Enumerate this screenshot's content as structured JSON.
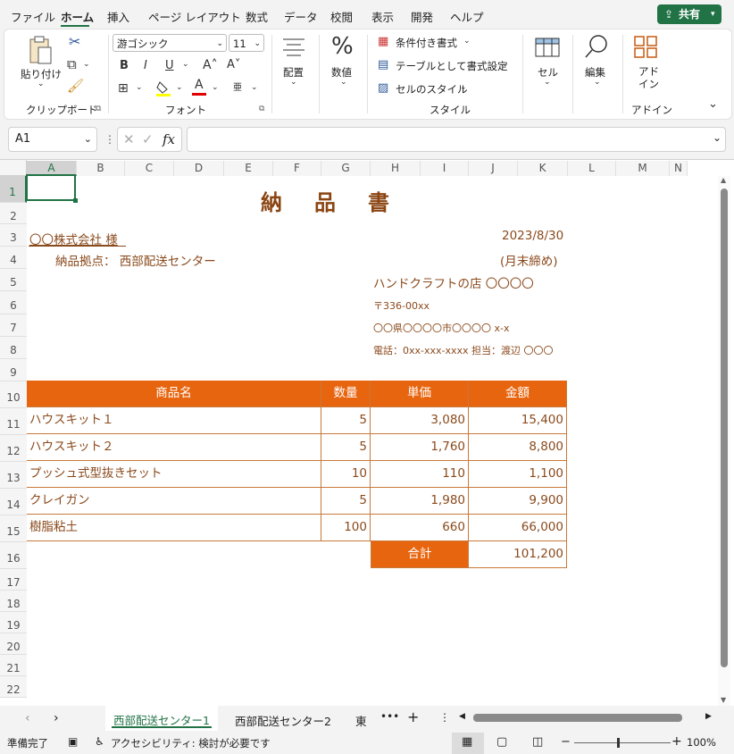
{
  "menu": {
    "items": [
      "ファイル",
      "ホーム",
      "挿入",
      "ページ レイアウト",
      "数式",
      "データ",
      "校閲",
      "表示",
      "開発",
      "ヘルプ"
    ],
    "share_label": "共有"
  },
  "ribbon": {
    "clipboard": {
      "paste": "貼り付け",
      "group": "クリップボード"
    },
    "font": {
      "name": "游ゴシック",
      "size": "11",
      "group": "フォント"
    },
    "alignment": {
      "label": "配置"
    },
    "number": {
      "label": "数値"
    },
    "styles": {
      "conditional": "条件付き書式",
      "table": "テーブルとして書式設定",
      "cell_styles": "セルのスタイル",
      "group": "スタイル"
    },
    "cells": {
      "label": "セル"
    },
    "editing": {
      "label": "編集"
    },
    "addins": {
      "label": "アド\nイン",
      "group": "アドイン"
    }
  },
  "formula_bar": {
    "name_box": "A1",
    "fx": "fx",
    "content": ""
  },
  "columns": [
    "A",
    "B",
    "C",
    "D",
    "E",
    "F",
    "G",
    "H",
    "I",
    "J",
    "K",
    "L",
    "M",
    "N"
  ],
  "rows": [
    "1",
    "2",
    "3",
    "4",
    "5",
    "6",
    "7",
    "8",
    "9",
    "10",
    "11",
    "12",
    "13",
    "14",
    "15",
    "16",
    "17",
    "18",
    "19",
    "20",
    "21",
    "22"
  ],
  "sheet": {
    "title": "納　品　書",
    "customer": "〇〇株式会社 様",
    "delivery_point": "納品拠点： 西部配送センター",
    "date": "2023/8/30",
    "closing": "(月末締め)",
    "shop": "ハンドクラフトの店 〇〇〇〇",
    "postal": "〒336-00xx",
    "address": "〇〇県〇〇〇〇市〇〇〇〇 x-x",
    "phone": "電話：0xx-xxx-xxxx 担当：渡辺 〇〇〇",
    "table": {
      "headers": [
        "商品名",
        "数量",
        "単価",
        "金額"
      ],
      "rows": [
        [
          "ハウスキット１",
          "5",
          "3,080",
          "15,400"
        ],
        [
          "ハウスキット２",
          "5",
          "1,760",
          "8,800"
        ],
        [
          "プッシュ式型抜きセット",
          "10",
          "110",
          "1,100"
        ],
        [
          "クレイガン",
          "5",
          "1,980",
          "9,900"
        ],
        [
          "樹脂粘土",
          "100",
          "660",
          "66,000"
        ]
      ],
      "total_label": "合計",
      "total_value": "101,200"
    }
  },
  "tabs": {
    "items": [
      "西部配送センター1",
      "西部配送センター2",
      "東"
    ],
    "active": 0
  },
  "status": {
    "ready": "準備完了",
    "accessibility": "アクセシビリティ: 検討が必要です",
    "zoom": "100%"
  },
  "colors": {
    "accent": "#217346",
    "header_fill": "#e8650f",
    "text": "#8a4a1c",
    "title": "#8b4513"
  }
}
